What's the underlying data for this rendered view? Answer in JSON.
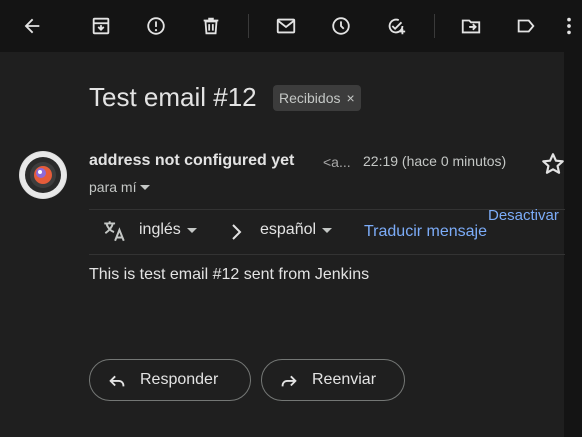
{
  "toolbar": {
    "icons": [
      "back-icon",
      "archive-icon",
      "report-spam-icon",
      "delete-icon",
      "mark-unread-icon",
      "snooze-icon",
      "add-task-icon",
      "move-to-icon",
      "label-icon",
      "more-icon"
    ]
  },
  "message": {
    "subject": "Test email #12",
    "label": "Recibidos",
    "label_remove": "×",
    "sender_name": "address not configured yet",
    "sender_email": "<a...",
    "time": "22:19 (hace 0 minutos)",
    "to": "para mí",
    "body": "This is test email #12 sent from Jenkins"
  },
  "translate": {
    "from_lang": "inglés",
    "to_lang": "español",
    "translate_link": "Traducir mensaje",
    "disable_link": "Desactivar"
  },
  "actions": {
    "reply": "Responder",
    "forward": "Reenviar"
  },
  "colors": {
    "background": "#1f1f1f",
    "toolbar": "#141414",
    "link": "#7cacf8"
  }
}
